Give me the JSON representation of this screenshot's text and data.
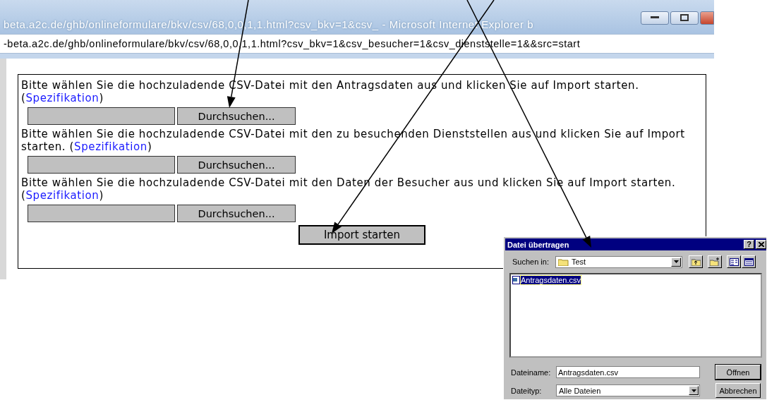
{
  "browser": {
    "title": "beta.a2c.de/ghb/onlineformulare/bkv/csv/68,0,0,1,1.html?csv_bkv=1&csv_ - Microsoft Internet Explorer b",
    "address": "-beta.a2c.de/ghb/onlineformulare/bkv/csv/68,0,0,1,1.html?csv_bkv=1&csv_besucher=1&csv_dienststelle=1&&src=start"
  },
  "form": {
    "sections": [
      {
        "text": "Bitte wählen Sie die hochzuladende CSV-Datei mit den Antragsdaten aus und klicken Sie auf Import starten.",
        "before_link": "(",
        "link": "Spezifikation",
        "after_link": ")",
        "browse_button": "Durchsuchen..."
      },
      {
        "text": "Bitte wählen Sie die hochzuladende CSV-Datei mit den zu besuchenden Dienststellen aus und klicken Sie auf Import starten.",
        "before_link": "(",
        "link": "Spezifikation",
        "after_link": ")",
        "browse_button": "Durchsuchen..."
      },
      {
        "text": "Bitte wählen Sie die hochzuladende CSV-Datei mit den Daten der Besucher aus und klicken Sie auf Import starten.",
        "before_link": "(",
        "link": "Spezifikation",
        "after_link": ")",
        "browse_button": "Durchsuchen..."
      }
    ],
    "submit_button": "Import starten"
  },
  "dialog": {
    "title": "Datei übertragen",
    "help_button": "?",
    "look_in": {
      "label": "Suchen in:",
      "value": "Test"
    },
    "files": [
      {
        "name": "Antragsdaten.csv",
        "selected": true
      }
    ],
    "filename": {
      "label": "Dateiname:",
      "value": "Antragsdaten.csv"
    },
    "filetype": {
      "label": "Dateityp:",
      "value": "Alle Dateien"
    },
    "buttons": [
      "Öffnen",
      "Abbrechen"
    ]
  }
}
